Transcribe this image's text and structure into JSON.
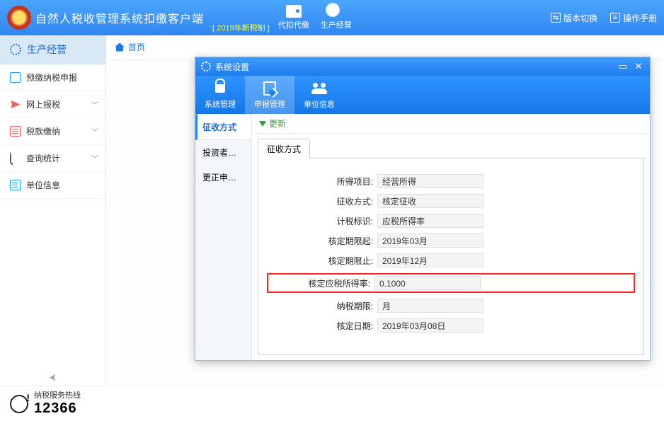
{
  "header": {
    "app_title": "自然人税收管理系统扣缴客户端",
    "year_badge": "[ 2019年新税制 ]",
    "btn1": "代扣代缴",
    "btn2": "生产经营",
    "link_version": "版本切换",
    "link_manual": "操作手册"
  },
  "sidebar": {
    "section": "生产经营",
    "items": [
      {
        "label": "预缴纳税申报",
        "expandable": false
      },
      {
        "label": "网上报税",
        "expandable": true
      },
      {
        "label": "税款缴纳",
        "expandable": true
      },
      {
        "label": "查询统计",
        "expandable": true
      },
      {
        "label": "单位信息",
        "expandable": false
      }
    ]
  },
  "breadcrumb": {
    "home": "首页"
  },
  "dialog": {
    "title": "系统设置",
    "tabs": {
      "sys": "系统管理",
      "decl": "申报管理",
      "unit": "单位信息"
    },
    "side": {
      "method": "征收方式",
      "investor": "投资者信息",
      "correction": "更正申报备份"
    },
    "toolbar": {
      "refresh": "更新"
    },
    "inner_tab": "征收方式",
    "form": {
      "income_item": {
        "label": "所得项目:",
        "value": "经营所得"
      },
      "levy_method": {
        "label": "征收方式:",
        "value": "核定征收"
      },
      "tax_flag": {
        "label": "计税标识:",
        "value": "应税所得率"
      },
      "period_from": {
        "label": "核定期限起:",
        "value": "2019年03月"
      },
      "period_to": {
        "label": "核定期限止:",
        "value": "2019年12月"
      },
      "assess_rate": {
        "label": "核定应税所得率:",
        "value": "0.1000"
      },
      "pay_period": {
        "label": "纳税期限:",
        "value": "月"
      },
      "assess_date": {
        "label": "核定日期:",
        "value": "2019年03月08日"
      }
    }
  },
  "footer": {
    "hotline_label": "纳税服务热线",
    "hotline_number": "12366"
  }
}
